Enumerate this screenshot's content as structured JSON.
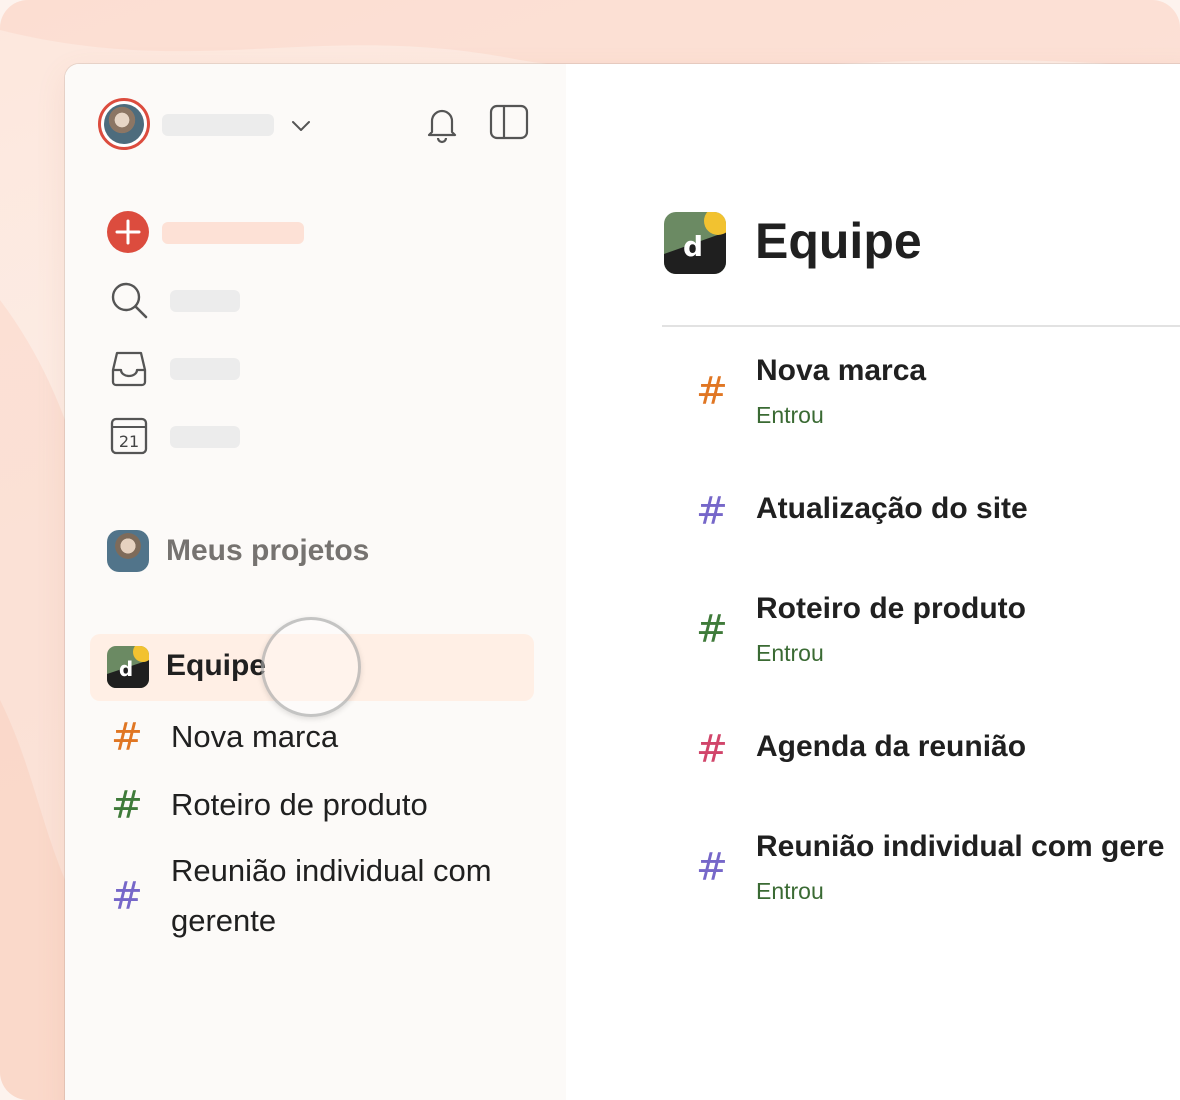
{
  "sidebar": {
    "projects_header": "Meus projetos",
    "team": {
      "label": "Equipe",
      "logo_letter": "d"
    },
    "projects": [
      {
        "label": "Nova marca",
        "color": "#e07623"
      },
      {
        "label": "Roteiro de produto",
        "color": "#3f7b3a"
      },
      {
        "label": "Reunião individual com",
        "label_line2": "gerente",
        "color": "#7667c9"
      }
    ],
    "nav_icons": [
      "add-icon",
      "search-icon",
      "inbox-icon",
      "calendar-icon"
    ],
    "calendar_day": "21"
  },
  "main": {
    "title": "Equipe",
    "logo_letter": "d",
    "items": [
      {
        "name": "Nova marca",
        "status": "Entrou",
        "color": "#e07623"
      },
      {
        "name": "Atualização do site",
        "status": "",
        "color": "#7667c9"
      },
      {
        "name": "Roteiro de produto",
        "status": "Entrou",
        "color": "#3f7b3a"
      },
      {
        "name": "Agenda da reunião",
        "status": "",
        "color": "#d1456a"
      },
      {
        "name": "Reunião individual com gere",
        "status": "Entrou",
        "color": "#7667c9"
      }
    ]
  },
  "colors": {
    "accent": "#dc4c3e",
    "selected_bg": "#ffefe5",
    "joined_text": "#3a6a33"
  }
}
